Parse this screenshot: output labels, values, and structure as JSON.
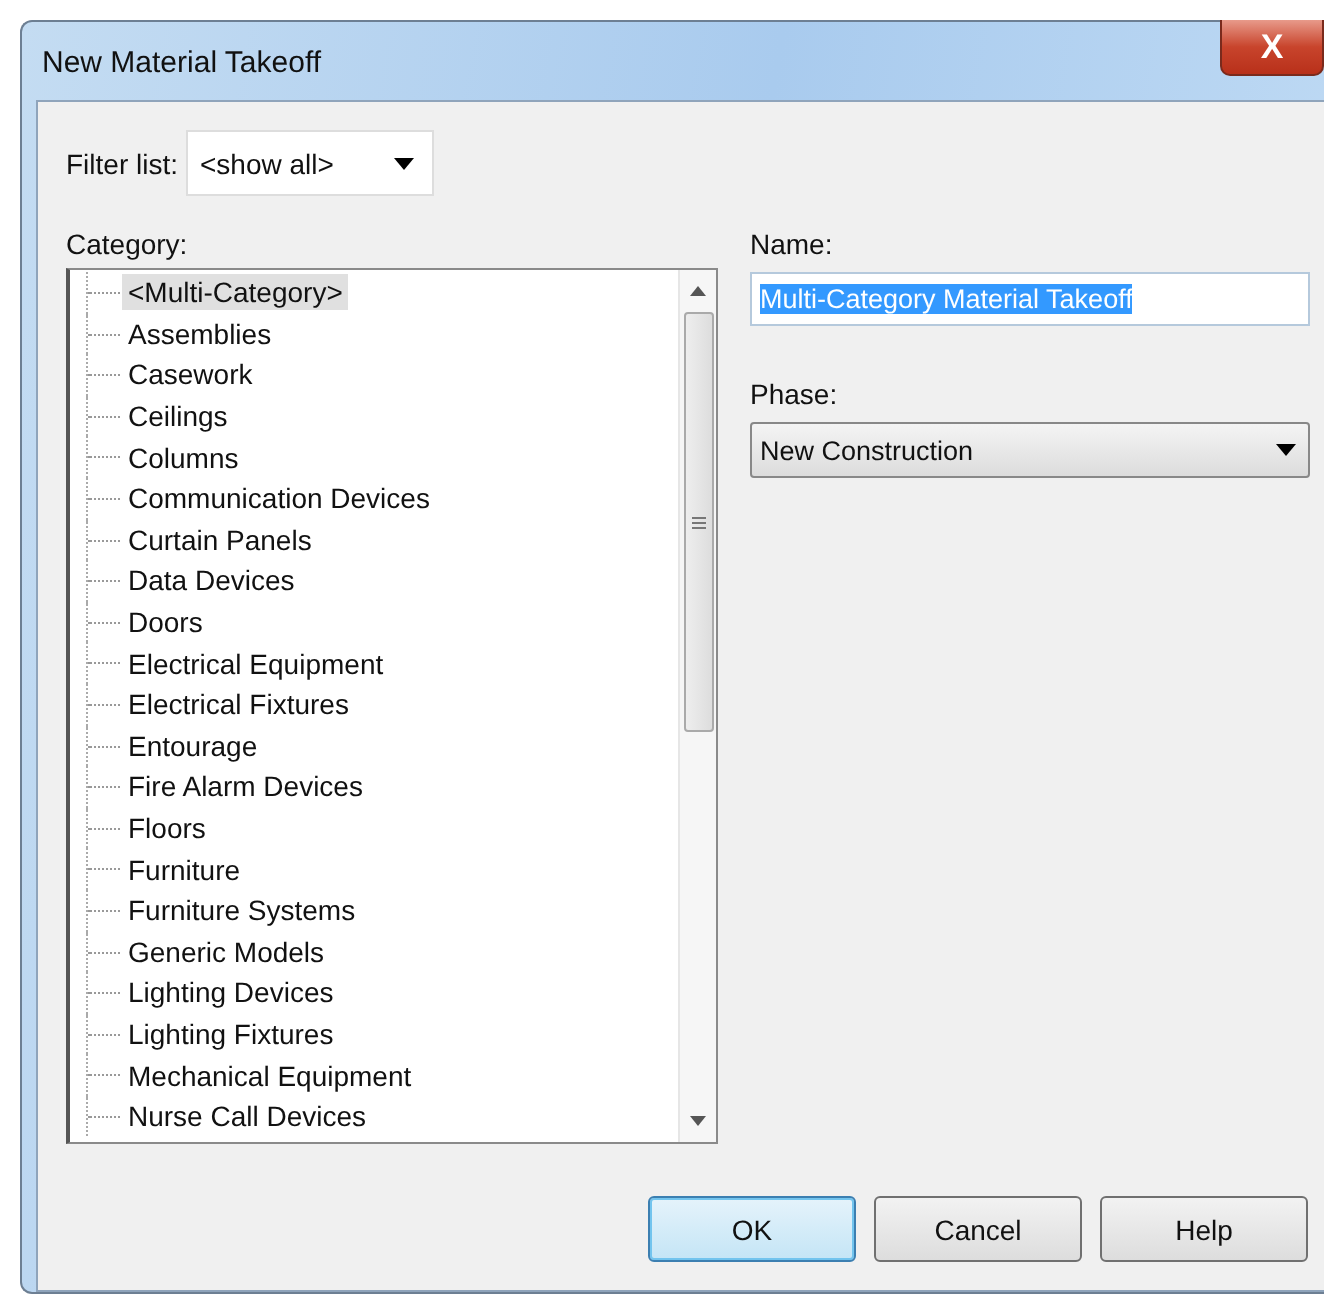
{
  "window": {
    "title": "New Material Takeoff",
    "close": "X"
  },
  "filter": {
    "label": "Filter list:",
    "value": "<show all>"
  },
  "category": {
    "label": "Category:",
    "items": [
      {
        "label": "<Multi-Category>",
        "selected": true
      },
      {
        "label": "Assemblies",
        "selected": false
      },
      {
        "label": "Casework",
        "selected": false
      },
      {
        "label": "Ceilings",
        "selected": false
      },
      {
        "label": "Columns",
        "selected": false
      },
      {
        "label": "Communication Devices",
        "selected": false
      },
      {
        "label": "Curtain Panels",
        "selected": false
      },
      {
        "label": "Data Devices",
        "selected": false
      },
      {
        "label": "Doors",
        "selected": false
      },
      {
        "label": "Electrical Equipment",
        "selected": false
      },
      {
        "label": "Electrical Fixtures",
        "selected": false
      },
      {
        "label": "Entourage",
        "selected": false
      },
      {
        "label": "Fire Alarm Devices",
        "selected": false
      },
      {
        "label": "Floors",
        "selected": false
      },
      {
        "label": "Furniture",
        "selected": false
      },
      {
        "label": "Furniture Systems",
        "selected": false
      },
      {
        "label": "Generic Models",
        "selected": false
      },
      {
        "label": "Lighting Devices",
        "selected": false
      },
      {
        "label": "Lighting Fixtures",
        "selected": false
      },
      {
        "label": "Mechanical Equipment",
        "selected": false
      },
      {
        "label": "Nurse Call Devices",
        "selected": false
      }
    ]
  },
  "name": {
    "label": "Name:",
    "value": "Multi-Category Material Takeoff"
  },
  "phase": {
    "label": "Phase:",
    "value": "New Construction"
  },
  "buttons": [
    {
      "label": "OK",
      "default": true
    },
    {
      "label": "Cancel",
      "default": false
    },
    {
      "label": "Help",
      "default": false
    }
  ]
}
